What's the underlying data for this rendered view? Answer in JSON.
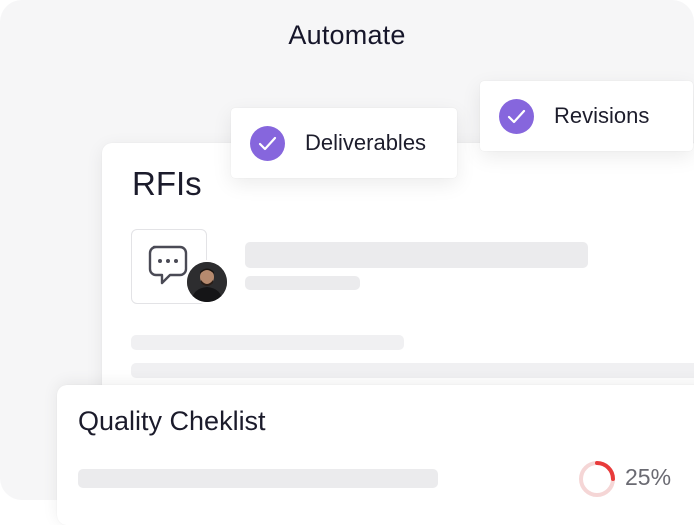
{
  "header": {
    "title": "Automate"
  },
  "rfi_card": {
    "title": "RFIs",
    "icon": "chat-bubble-icon",
    "avatar": "user-avatar"
  },
  "chips": [
    {
      "label": "Deliverables",
      "icon": "checkmark-icon",
      "color": "#8666dd"
    },
    {
      "label": "Revisions",
      "icon": "checkmark-icon",
      "color": "#8666dd"
    }
  ],
  "quality_card": {
    "title": "Quality Cheklist",
    "progress": 0.25,
    "progress_text": "25%",
    "progress_color": "#e83b3b",
    "progress_track_color": "#f5d6d6"
  }
}
